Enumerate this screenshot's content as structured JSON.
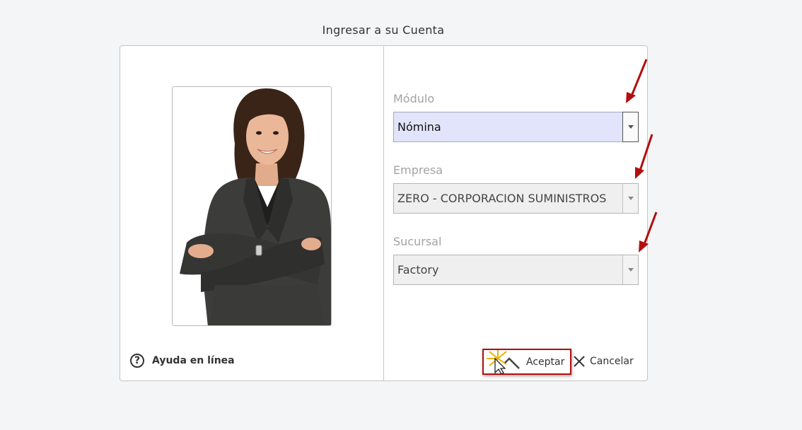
{
  "dialog": {
    "title": "Ingresar a su Cuenta",
    "help_label": "Ayuda en línea",
    "help_glyph": "?"
  },
  "fields": {
    "modulo": {
      "label": "Módulo",
      "value": "Nómina"
    },
    "empresa": {
      "label": "Empresa",
      "value": "ZERO - CORPORACION SUMINISTROS"
    },
    "sucursal": {
      "label": "Sucursal",
      "value": "Factory"
    }
  },
  "actions": {
    "accept_label": "Aceptar",
    "cancel_label": "Cancelar"
  },
  "colors": {
    "highlight_border": "#b30e0e",
    "active_select": "#e2e4fb",
    "annotation_arrow": "#b30e0e"
  }
}
